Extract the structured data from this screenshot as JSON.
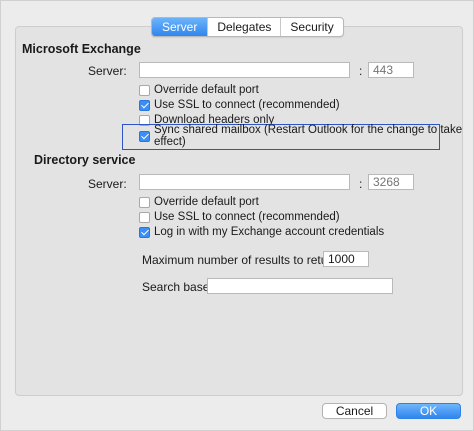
{
  "tabs": [
    {
      "label": "Server",
      "active": true
    },
    {
      "label": "Delegates",
      "active": false
    },
    {
      "label": "Security",
      "active": false
    }
  ],
  "exchange": {
    "title": "Microsoft Exchange",
    "server_label": "Server:",
    "server_value": "",
    "colon": ":",
    "port_placeholder": "443",
    "options": [
      {
        "label": "Override default port",
        "checked": false
      },
      {
        "label": "Use SSL to connect (recommended)",
        "checked": true
      },
      {
        "label": "Download headers only",
        "checked": false
      },
      {
        "label": "Sync shared mailbox (Restart Outlook for the change to take effect)",
        "checked": true
      }
    ]
  },
  "directory": {
    "title": "Directory service",
    "server_label": "Server:",
    "server_value": "",
    "colon": ":",
    "port_placeholder": "3268",
    "options": [
      {
        "label": "Override default port",
        "checked": false
      },
      {
        "label": "Use SSL to connect (recommended)",
        "checked": false
      },
      {
        "label": "Log in with my Exchange account credentials",
        "checked": true
      }
    ],
    "max_results_label": "Maximum number of results to return:",
    "max_results_value": "1000",
    "search_base_label": "Search base:",
    "search_base_value": ""
  },
  "buttons": {
    "cancel": "Cancel",
    "ok": "OK"
  },
  "colors": {
    "accent": "#2f86ee",
    "highlight_border": "#2f55c4"
  }
}
